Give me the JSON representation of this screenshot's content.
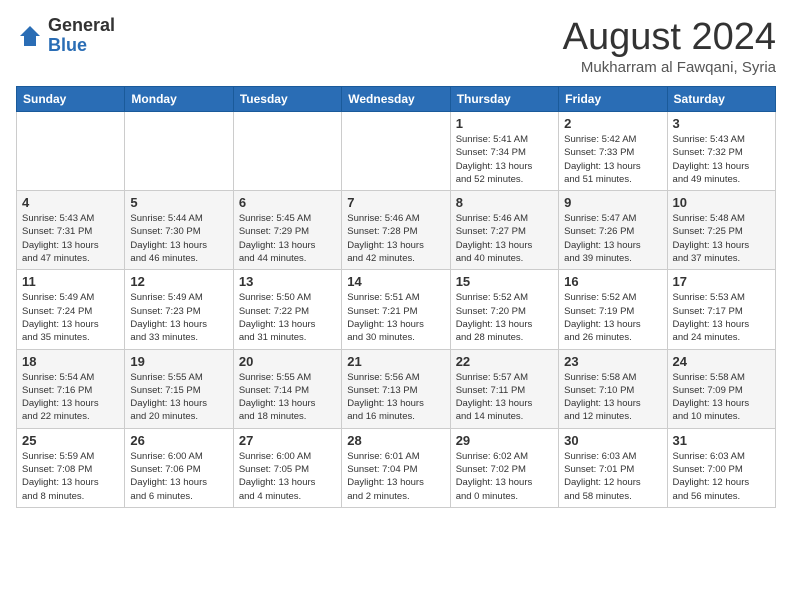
{
  "logo": {
    "general": "General",
    "blue": "Blue"
  },
  "title": {
    "month_year": "August 2024",
    "location": "Mukharram al Fawqani, Syria"
  },
  "weekdays": [
    "Sunday",
    "Monday",
    "Tuesday",
    "Wednesday",
    "Thursday",
    "Friday",
    "Saturday"
  ],
  "weeks": [
    [
      {
        "day": "",
        "info": ""
      },
      {
        "day": "",
        "info": ""
      },
      {
        "day": "",
        "info": ""
      },
      {
        "day": "",
        "info": ""
      },
      {
        "day": "1",
        "info": "Sunrise: 5:41 AM\nSunset: 7:34 PM\nDaylight: 13 hours\nand 52 minutes."
      },
      {
        "day": "2",
        "info": "Sunrise: 5:42 AM\nSunset: 7:33 PM\nDaylight: 13 hours\nand 51 minutes."
      },
      {
        "day": "3",
        "info": "Sunrise: 5:43 AM\nSunset: 7:32 PM\nDaylight: 13 hours\nand 49 minutes."
      }
    ],
    [
      {
        "day": "4",
        "info": "Sunrise: 5:43 AM\nSunset: 7:31 PM\nDaylight: 13 hours\nand 47 minutes."
      },
      {
        "day": "5",
        "info": "Sunrise: 5:44 AM\nSunset: 7:30 PM\nDaylight: 13 hours\nand 46 minutes."
      },
      {
        "day": "6",
        "info": "Sunrise: 5:45 AM\nSunset: 7:29 PM\nDaylight: 13 hours\nand 44 minutes."
      },
      {
        "day": "7",
        "info": "Sunrise: 5:46 AM\nSunset: 7:28 PM\nDaylight: 13 hours\nand 42 minutes."
      },
      {
        "day": "8",
        "info": "Sunrise: 5:46 AM\nSunset: 7:27 PM\nDaylight: 13 hours\nand 40 minutes."
      },
      {
        "day": "9",
        "info": "Sunrise: 5:47 AM\nSunset: 7:26 PM\nDaylight: 13 hours\nand 39 minutes."
      },
      {
        "day": "10",
        "info": "Sunrise: 5:48 AM\nSunset: 7:25 PM\nDaylight: 13 hours\nand 37 minutes."
      }
    ],
    [
      {
        "day": "11",
        "info": "Sunrise: 5:49 AM\nSunset: 7:24 PM\nDaylight: 13 hours\nand 35 minutes."
      },
      {
        "day": "12",
        "info": "Sunrise: 5:49 AM\nSunset: 7:23 PM\nDaylight: 13 hours\nand 33 minutes."
      },
      {
        "day": "13",
        "info": "Sunrise: 5:50 AM\nSunset: 7:22 PM\nDaylight: 13 hours\nand 31 minutes."
      },
      {
        "day": "14",
        "info": "Sunrise: 5:51 AM\nSunset: 7:21 PM\nDaylight: 13 hours\nand 30 minutes."
      },
      {
        "day": "15",
        "info": "Sunrise: 5:52 AM\nSunset: 7:20 PM\nDaylight: 13 hours\nand 28 minutes."
      },
      {
        "day": "16",
        "info": "Sunrise: 5:52 AM\nSunset: 7:19 PM\nDaylight: 13 hours\nand 26 minutes."
      },
      {
        "day": "17",
        "info": "Sunrise: 5:53 AM\nSunset: 7:17 PM\nDaylight: 13 hours\nand 24 minutes."
      }
    ],
    [
      {
        "day": "18",
        "info": "Sunrise: 5:54 AM\nSunset: 7:16 PM\nDaylight: 13 hours\nand 22 minutes."
      },
      {
        "day": "19",
        "info": "Sunrise: 5:55 AM\nSunset: 7:15 PM\nDaylight: 13 hours\nand 20 minutes."
      },
      {
        "day": "20",
        "info": "Sunrise: 5:55 AM\nSunset: 7:14 PM\nDaylight: 13 hours\nand 18 minutes."
      },
      {
        "day": "21",
        "info": "Sunrise: 5:56 AM\nSunset: 7:13 PM\nDaylight: 13 hours\nand 16 minutes."
      },
      {
        "day": "22",
        "info": "Sunrise: 5:57 AM\nSunset: 7:11 PM\nDaylight: 13 hours\nand 14 minutes."
      },
      {
        "day": "23",
        "info": "Sunrise: 5:58 AM\nSunset: 7:10 PM\nDaylight: 13 hours\nand 12 minutes."
      },
      {
        "day": "24",
        "info": "Sunrise: 5:58 AM\nSunset: 7:09 PM\nDaylight: 13 hours\nand 10 minutes."
      }
    ],
    [
      {
        "day": "25",
        "info": "Sunrise: 5:59 AM\nSunset: 7:08 PM\nDaylight: 13 hours\nand 8 minutes."
      },
      {
        "day": "26",
        "info": "Sunrise: 6:00 AM\nSunset: 7:06 PM\nDaylight: 13 hours\nand 6 minutes."
      },
      {
        "day": "27",
        "info": "Sunrise: 6:00 AM\nSunset: 7:05 PM\nDaylight: 13 hours\nand 4 minutes."
      },
      {
        "day": "28",
        "info": "Sunrise: 6:01 AM\nSunset: 7:04 PM\nDaylight: 13 hours\nand 2 minutes."
      },
      {
        "day": "29",
        "info": "Sunrise: 6:02 AM\nSunset: 7:02 PM\nDaylight: 13 hours\nand 0 minutes."
      },
      {
        "day": "30",
        "info": "Sunrise: 6:03 AM\nSunset: 7:01 PM\nDaylight: 12 hours\nand 58 minutes."
      },
      {
        "day": "31",
        "info": "Sunrise: 6:03 AM\nSunset: 7:00 PM\nDaylight: 12 hours\nand 56 minutes."
      }
    ]
  ]
}
